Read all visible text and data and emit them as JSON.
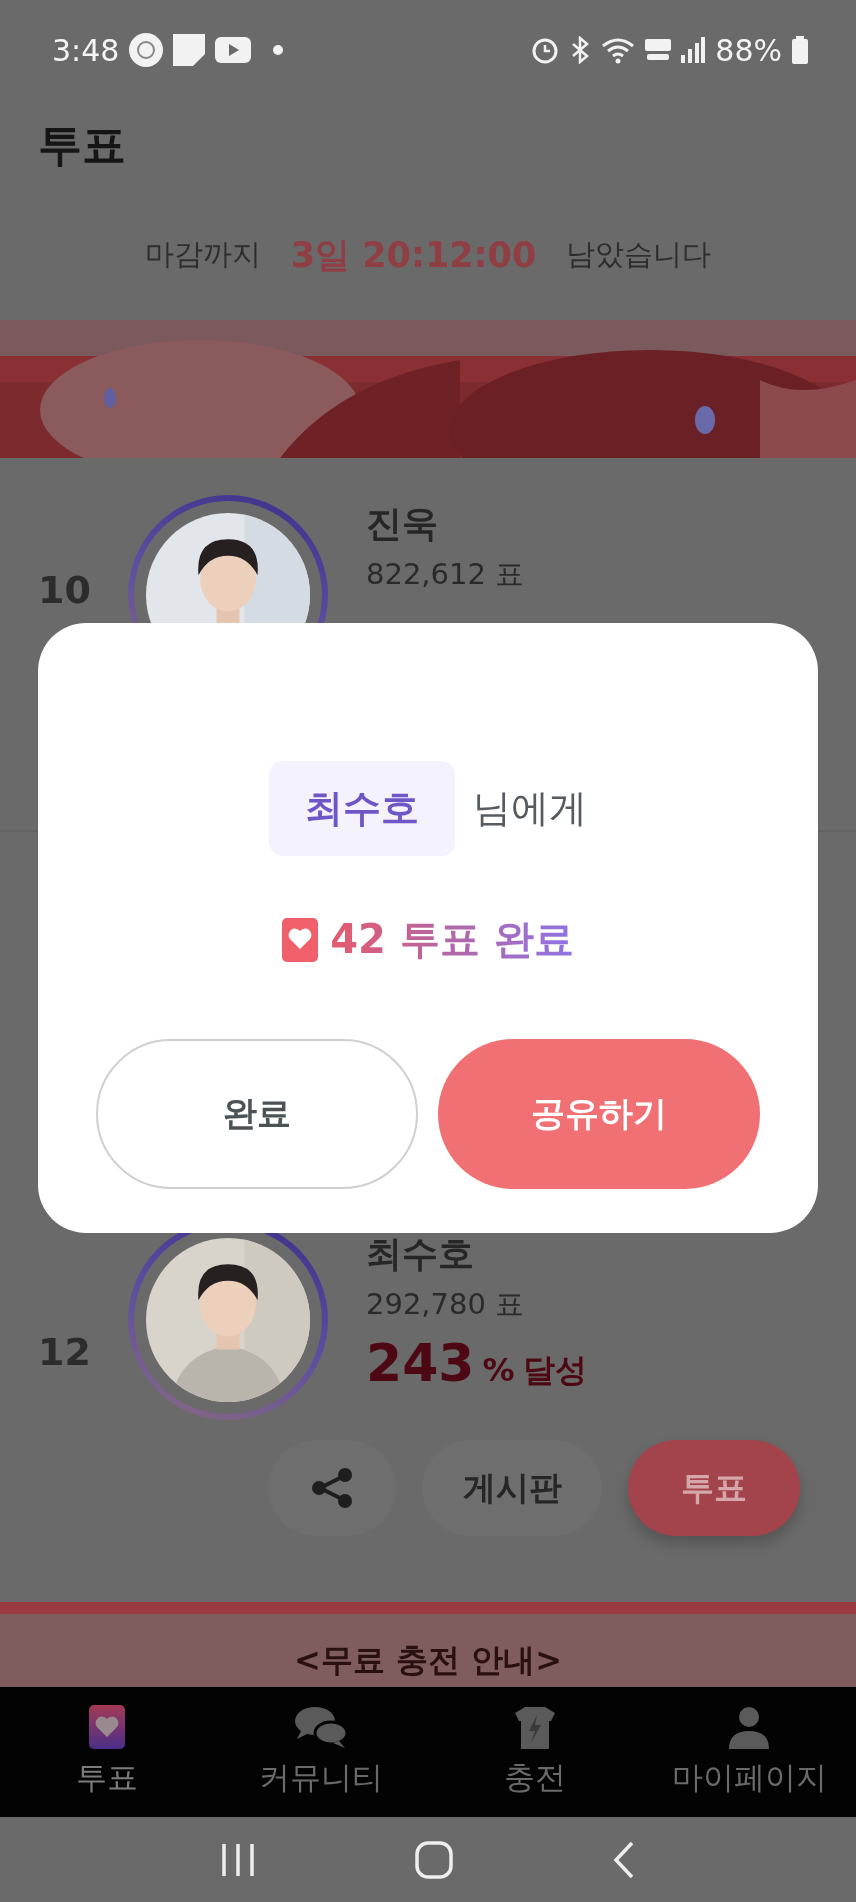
{
  "status_bar": {
    "time": "3:48",
    "battery": "88%"
  },
  "header": {
    "title": "투표"
  },
  "deadline": {
    "prefix": "마감까지",
    "remaining": "3일 20:12:00",
    "suffix": "남았습니다"
  },
  "candidates": [
    {
      "rank": "10",
      "name": "진욱",
      "votes": "822,612 표"
    },
    {
      "rank": "12",
      "name": "최수호",
      "votes": "292,780 표",
      "percent": "243",
      "percent_unit": "%",
      "percent_label": "달성",
      "board_button": "게시판",
      "vote_button": "투표"
    }
  ],
  "notice_banner": {
    "text": "<무료 충전 안내>"
  },
  "dialog": {
    "recipient": "최수호",
    "recipient_suffix": "님에게",
    "result": "42 투표 완료",
    "buttons": [
      {
        "label": "완료",
        "kind": "secondary"
      },
      {
        "label": "공유하기",
        "kind": "primary"
      }
    ]
  },
  "bottom_nav": [
    {
      "label": "투표",
      "selected": true
    },
    {
      "label": "커뮤니티",
      "selected": false
    },
    {
      "label": "충전",
      "selected": false
    },
    {
      "label": "마이페이지",
      "selected": false
    }
  ]
}
